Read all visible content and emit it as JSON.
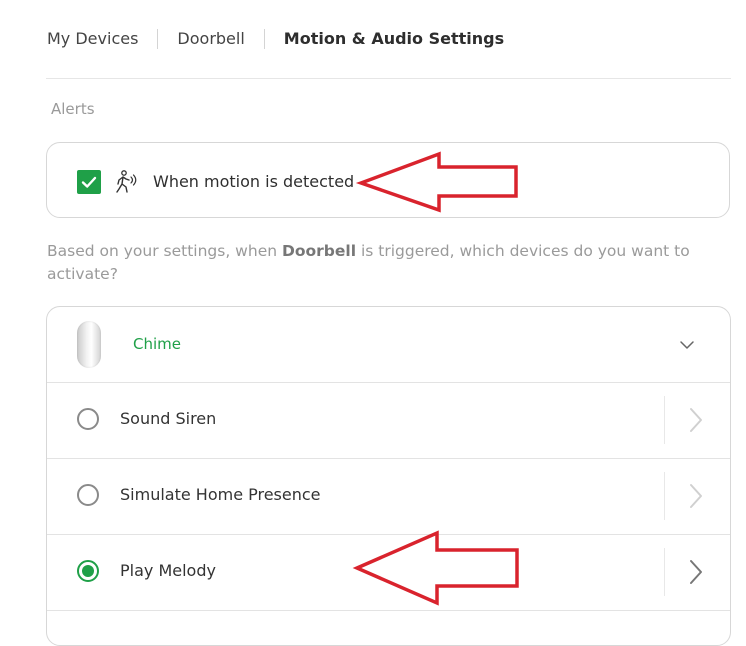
{
  "breadcrumb": {
    "items": [
      "My Devices",
      "Doorbell",
      "Motion & Audio Settings"
    ]
  },
  "alerts": {
    "section_label": "Alerts",
    "motion_checkbox_checked": true,
    "motion_label": "When motion is detected",
    "icon": "motion-person-icon"
  },
  "description": {
    "prefix": "Based on your settings, when ",
    "device": "Doorbell",
    "suffix": " is triggered, which devices do you want to activate?"
  },
  "device_list": {
    "device_name": "Chime",
    "device_icon": "chime-device-image",
    "options": [
      {
        "label": "Sound Siren",
        "selected": false
      },
      {
        "label": "Simulate Home Presence",
        "selected": false
      },
      {
        "label": "Play Melody",
        "selected": true
      }
    ]
  },
  "colors": {
    "accent_green": "#1fa048",
    "annotation_arrow": "#d9232d",
    "muted_text": "#9a9a9a",
    "border": "#d7d7d7"
  }
}
